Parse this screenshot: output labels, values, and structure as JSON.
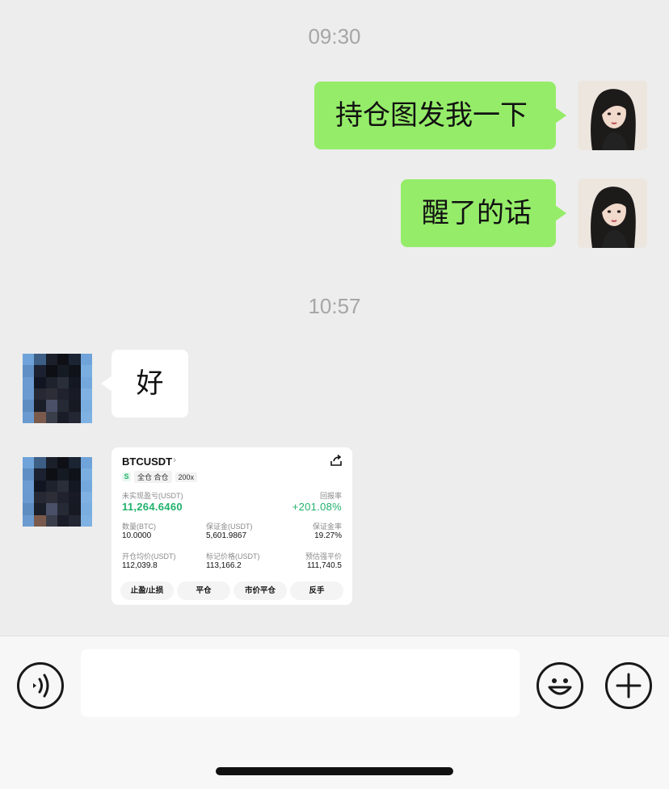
{
  "chat": {
    "timestamps": [
      "09:30",
      "10:57"
    ],
    "messages": [
      {
        "from": "me",
        "text": "持仓图发我一下"
      },
      {
        "from": "me",
        "text": "醒了的话"
      },
      {
        "from": "them",
        "text": "好"
      }
    ]
  },
  "position_card": {
    "symbol": "BTCUSDT",
    "chevron": "›",
    "s_badge": "S",
    "margin_mode": "全仓 合仓",
    "leverage": "200x",
    "unrealized_pnl_label": "未实现盈亏(USDT)",
    "unrealized_pnl": "11,264.6460",
    "roe_label": "回报率",
    "roe": "+201.08%",
    "size_label": "数量(BTC)",
    "size": "10.0000",
    "margin_label": "保证金(USDT)",
    "margin": "5,601.9867",
    "margin_ratio_label": "保证金率",
    "margin_ratio": "19.27%",
    "entry_price_label": "开仓均价(USDT)",
    "entry_price": "112,039.8",
    "mark_price_label": "标记价格(USDT)",
    "mark_price": "113,166.2",
    "liq_price_label": "预估强平价",
    "liq_price": "111,740.5",
    "buttons": [
      "止盈/止损",
      "平仓",
      "市价平仓",
      "反手"
    ]
  },
  "input_bar": {
    "voice_icon": "voice-icon",
    "emoji_icon": "emoji-icon",
    "plus_icon": "plus-icon",
    "input_value": ""
  },
  "colors": {
    "my_bubble": "#95ec69",
    "their_bubble": "#ffffff",
    "background": "#ededed",
    "pnl_green": "#20b26c"
  }
}
